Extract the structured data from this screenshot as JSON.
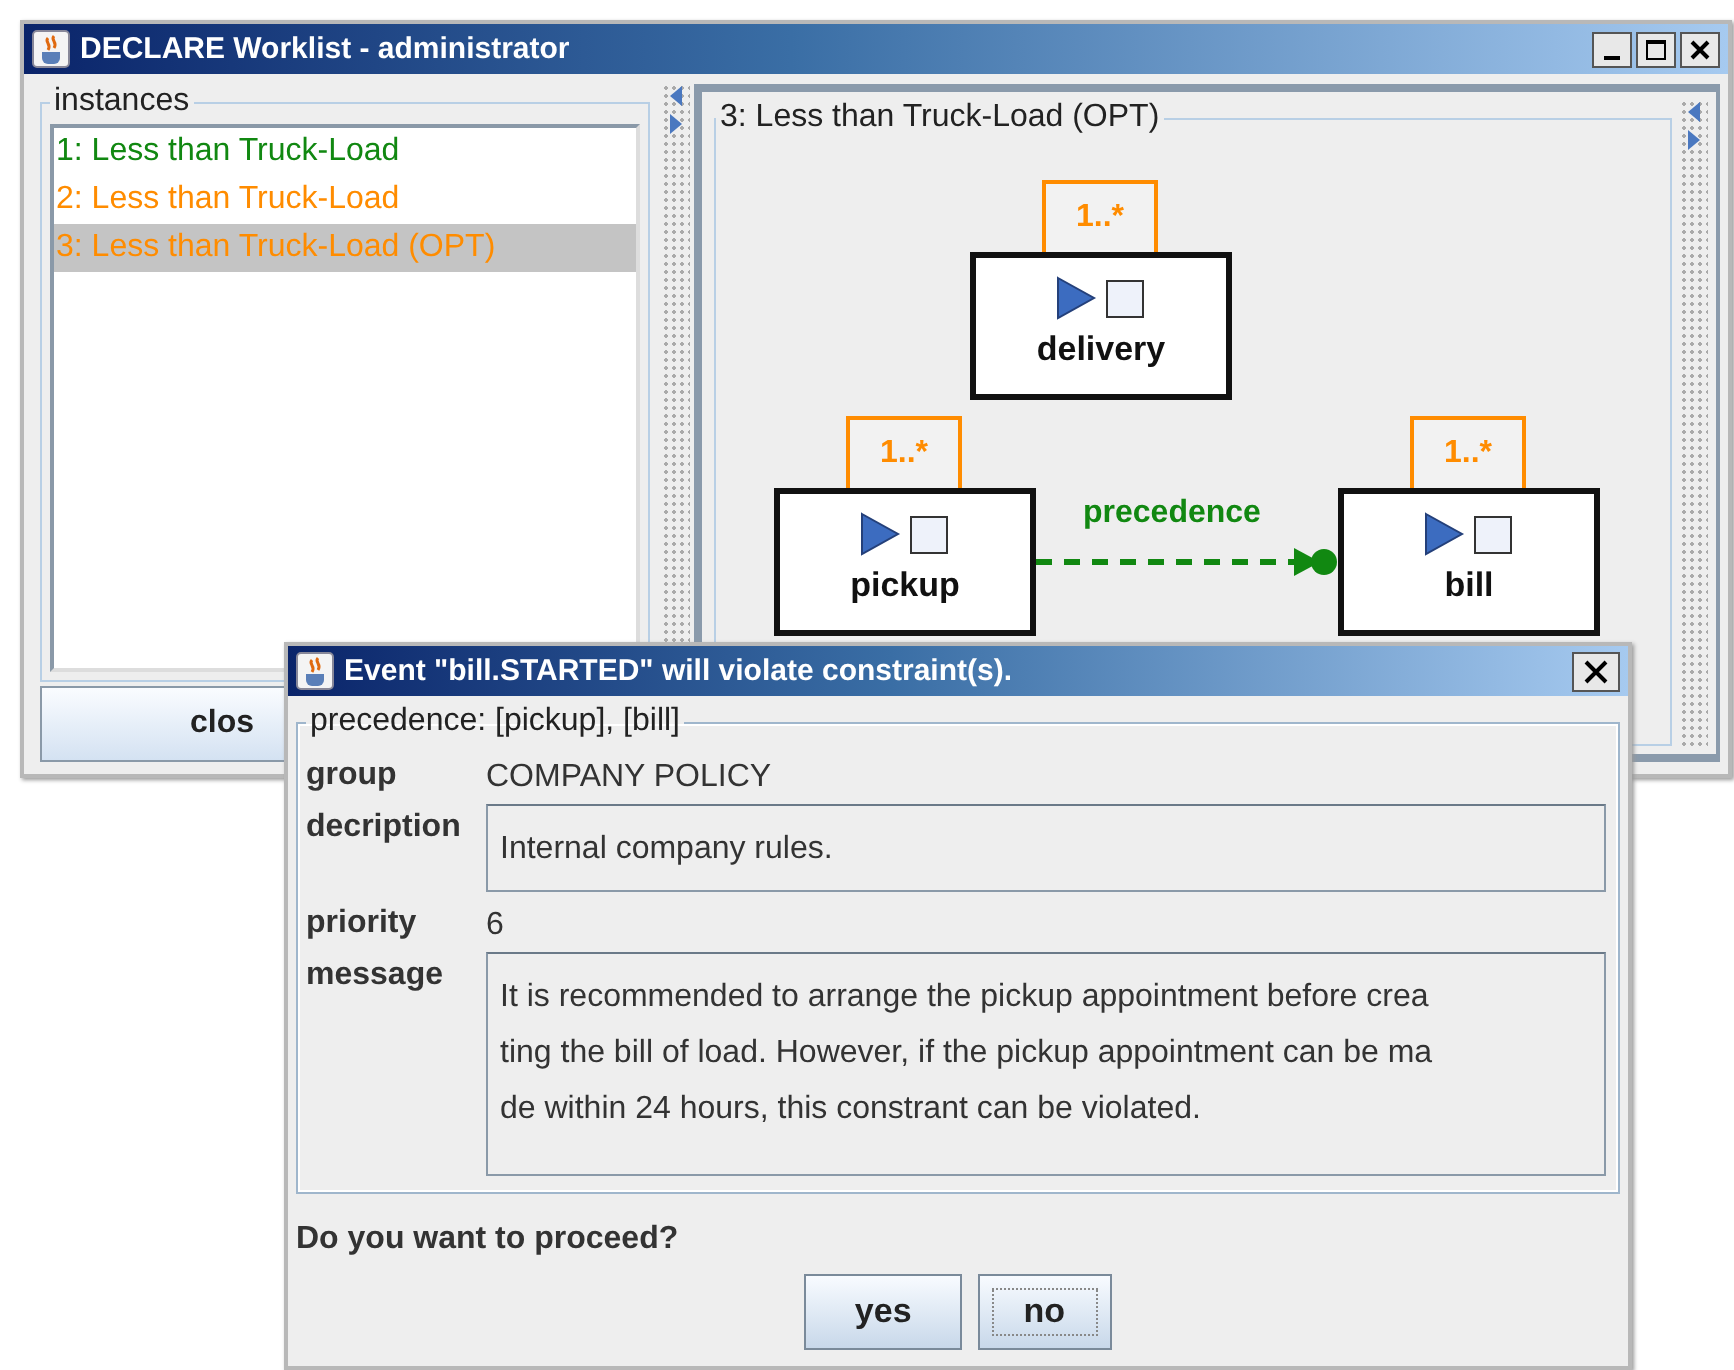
{
  "window": {
    "title": "DECLARE Worklist - administrator"
  },
  "instances": {
    "legend": "instances",
    "items": [
      {
        "label": "1: Less than Truck-Load",
        "color": "#118811",
        "selected": false
      },
      {
        "label": "2: Less than Truck-Load",
        "color": "#ff8c00",
        "selected": false
      },
      {
        "label": "3: Less than Truck-Load (OPT)",
        "color": "#ff8c00",
        "selected": true
      }
    ],
    "close_button": "clos"
  },
  "model": {
    "title": "3: Less than Truck-Load (OPT)",
    "activities": [
      {
        "name": "delivery",
        "cardinality": "1..*"
      },
      {
        "name": "pickup",
        "cardinality": "1..*"
      },
      {
        "name": "bill",
        "cardinality": "1..*"
      }
    ],
    "constraints": [
      {
        "label": "precedence"
      }
    ]
  },
  "dialog": {
    "title": "Event \"bill.STARTED\" will violate constraint(s).",
    "legend": "precedence: [pickup], [bill]",
    "fields": [
      {
        "label": "group",
        "kind": "text",
        "value": "COMPANY POLICY"
      },
      {
        "label": "decription",
        "kind": "box",
        "lines": [
          "Internal company rules."
        ]
      },
      {
        "label": "priority",
        "kind": "text",
        "value": "6"
      },
      {
        "label": "message",
        "kind": "box",
        "lines": [
          "It is recommended to arrange the pickup appointment before crea",
          "ting the bill of load. However, if the pickup appointment can be ma",
          "de within 24 hours, this constrant can be violated."
        ]
      }
    ],
    "question": "Do you want to proceed?",
    "buttons": [
      {
        "label": "yes",
        "focused": false
      },
      {
        "label": "no",
        "focused": true
      }
    ]
  }
}
